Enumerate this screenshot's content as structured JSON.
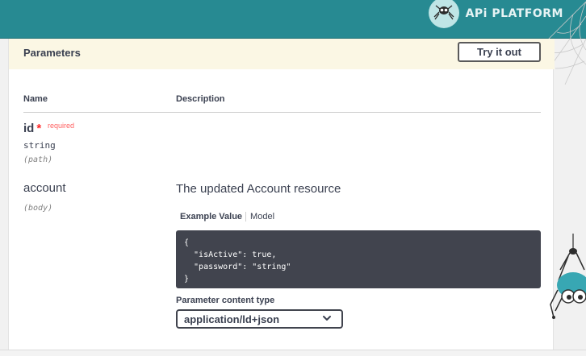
{
  "header": {
    "brand_text": "APi PLATFORM",
    "bg_color": "#278a92"
  },
  "parameters": {
    "title": "Parameters",
    "try_button": "Try it out",
    "columns": {
      "name": "Name",
      "description": "Description"
    },
    "items": [
      {
        "name": "id",
        "required_mark": "*",
        "required_text": "required",
        "type": "string",
        "in": "(path)",
        "description": ""
      },
      {
        "name": "account",
        "in": "(body)",
        "description": "The updated Account resource"
      }
    ],
    "tabs": {
      "example": "Example Value",
      "model": "Model"
    },
    "example_code": "{\n  \"isActive\": true,\n  \"password\": \"string\"\n}",
    "content_type_label": "Parameter content type",
    "content_type_value": "application/ld+json"
  },
  "icons": {
    "brand_logo": "spider-logo-icon",
    "select_chevron": "chevron-down-icon",
    "spider": "spider-mascot-icon",
    "web": "spiderweb-icon"
  }
}
